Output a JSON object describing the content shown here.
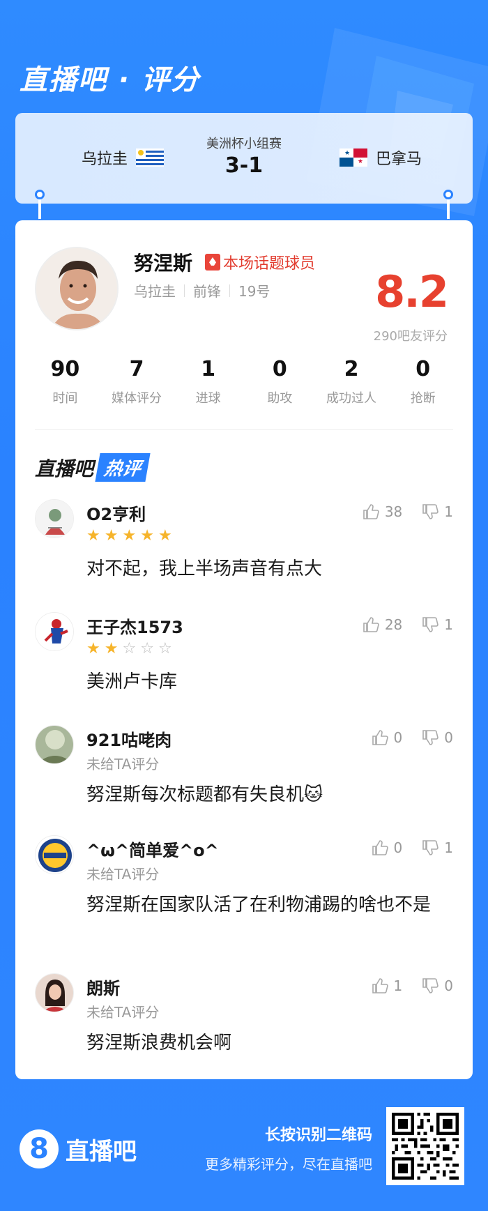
{
  "header": {
    "title": "直播吧 · 评分"
  },
  "match": {
    "competition": "美洲杯小组赛",
    "score": "3-1",
    "home_team": "乌拉圭",
    "away_team": "巴拿马"
  },
  "player": {
    "name": "努涅斯",
    "badge": "本场话题球员",
    "team": "乌拉圭",
    "position": "前锋",
    "number": "19号",
    "rating": "8.2",
    "rating_count": "290吧友评分"
  },
  "stats": [
    {
      "value": "90",
      "label": "时间"
    },
    {
      "value": "7",
      "label": "媒体评分"
    },
    {
      "value": "1",
      "label": "进球"
    },
    {
      "value": "0",
      "label": "助攻"
    },
    {
      "value": "2",
      "label": "成功过人"
    },
    {
      "value": "0",
      "label": "抢断"
    }
  ],
  "hot_comments": {
    "title_a": "直播吧",
    "title_b": "热评",
    "items": [
      {
        "user": "O2亨利",
        "stars": 5,
        "no_score": "",
        "text": "对不起，我上半场声音有点大",
        "likes": "38",
        "dislikes": "1"
      },
      {
        "user": "王子杰1573",
        "stars": 2,
        "no_score": "",
        "text": "美洲卢卡库",
        "likes": "28",
        "dislikes": "1"
      },
      {
        "user": "921咕咾肉",
        "stars": 0,
        "no_score": "未给TA评分",
        "text": "努涅斯每次标题都有失良机🐱",
        "likes": "0",
        "dislikes": "0"
      },
      {
        "user": "^ω^简单爱^o^",
        "stars": 0,
        "no_score": "未给TA评分",
        "text": "努涅斯在国家队活了在利物浦踢的啥也不是",
        "likes": "0",
        "dislikes": "1"
      },
      {
        "user": "朗斯",
        "stars": 0,
        "no_score": "未给TA评分",
        "text": "努涅斯浪费机会啊",
        "likes": "1",
        "dislikes": "0"
      }
    ]
  },
  "footer": {
    "logo_mark": "8",
    "logo_text": "直播吧",
    "line1": "长按识别二维码",
    "line2": "更多精彩评分，尽在直播吧"
  },
  "colors": {
    "brand_blue": "#2a82ff",
    "rating_red": "#e7412f",
    "star_gold": "#f6b42b"
  }
}
